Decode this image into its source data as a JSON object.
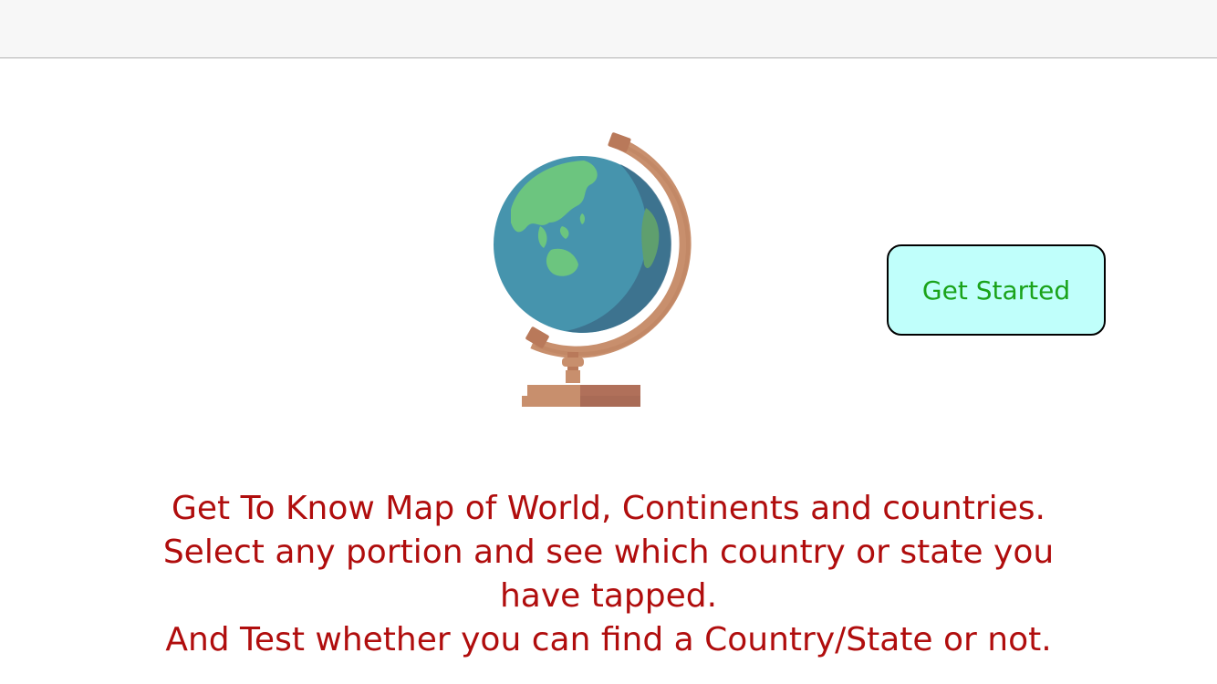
{
  "nav_bar": {
    "title": ""
  },
  "illustration": {
    "icon": "globe-icon"
  },
  "buttons": {
    "get_started_label": "Get Started"
  },
  "description": {
    "line1": "Get To Know Map of World, Continents and countries.",
    "line2": "Select any portion and see which country or state you",
    "line3": "have tapped.",
    "line4": "And Test whether you can find a Country/State or not."
  },
  "colors": {
    "nav_background": "#f7f7f7",
    "button_background": "#c0fffb",
    "button_text": "#1aa31a",
    "description_text": "#b00d0d",
    "globe_ocean": "#4694ad",
    "globe_land": "#6cc57f",
    "globe_stand": "#c88f6d"
  }
}
